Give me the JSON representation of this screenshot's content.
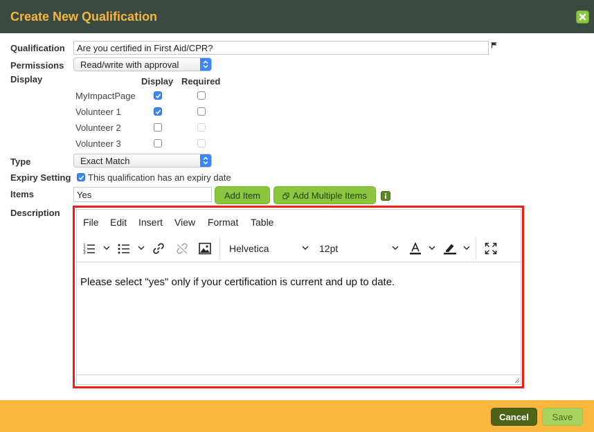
{
  "dialog": {
    "title": "Create New Qualification",
    "close_icon": "close-x-icon"
  },
  "form": {
    "qualification_label": "Qualification",
    "qualification_value": "Are you certified in First Aid/CPR?",
    "flag_icon": "flag-icon",
    "permissions_label": "Permissions",
    "permissions_value": "Read/write with approval",
    "display_label": "Display",
    "display_col_header": "Display",
    "required_col_header": "Required",
    "display_rows": [
      {
        "name": "MyImpactPage",
        "display": true,
        "required": false,
        "required_enabled": true
      },
      {
        "name": "Volunteer 1",
        "display": true,
        "required": false,
        "required_enabled": true
      },
      {
        "name": "Volunteer 2",
        "display": false,
        "required": false,
        "required_enabled": false
      },
      {
        "name": "Volunteer 3",
        "display": false,
        "required": false,
        "required_enabled": false
      }
    ],
    "type_label": "Type",
    "type_value": "Exact Match",
    "expiry_label": "Expiry Setting",
    "expiry_text": "This qualification has an expiry date",
    "expiry_checked": true,
    "items_label": "Items",
    "items_value": "Yes",
    "add_item_label": "Add Item",
    "add_multiple_label": "Add Multiple Items",
    "description_label": "Description"
  },
  "editor": {
    "menu": [
      "File",
      "Edit",
      "Insert",
      "View",
      "Format",
      "Table"
    ],
    "font_family": "Helvetica",
    "font_size": "12pt",
    "content": "Please select \"yes\" only if your certification is current and up to date."
  },
  "footer": {
    "cancel_label": "Cancel",
    "save_label": "Save"
  },
  "colors": {
    "header_bg": "#3a4a40",
    "title": "#f5b63c",
    "accent_green": "#8cc63f",
    "footer_bg": "#fab73d",
    "highlight": "#f41c14",
    "checkbox_blue": "#3b87f5"
  }
}
